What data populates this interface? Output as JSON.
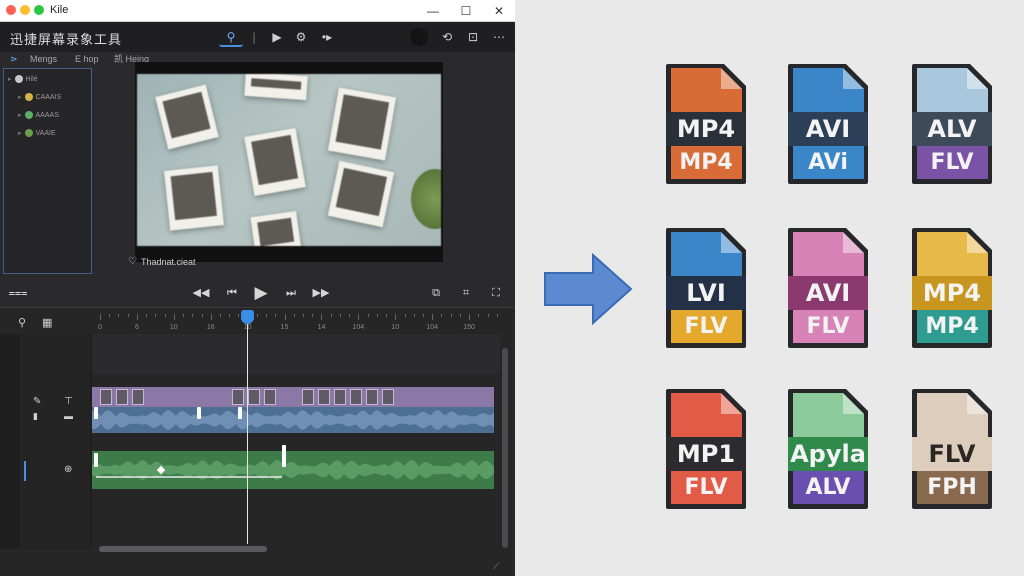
{
  "window": {
    "title": "Kile",
    "controls": {
      "minimize": "—",
      "maximize": "☐",
      "close": "✕"
    }
  },
  "app": {
    "name": "迅捷屏幕录象工具",
    "toolbar": {
      "search": "⚲",
      "sep": "|",
      "play": "▶",
      "gear": "⚙",
      "more": "•▸",
      "back": "⟲",
      "frame": "⊡",
      "dots": "⋯"
    }
  },
  "sidebar": {
    "tabs": [
      "Mengs",
      "E hop",
      "凯 Heing"
    ],
    "items": [
      {
        "label": "Hilé",
        "icon_color": "#c8c8c8"
      },
      {
        "label": "CAAAIS",
        "icon_color": "#d4b44a"
      },
      {
        "label": "AAAAS",
        "icon_color": "#5cae6a"
      },
      {
        "label": "VAAIE",
        "icon_color": "#6aa04a"
      }
    ]
  },
  "preview": {
    "label": "Thadnat.cieat"
  },
  "transport": {
    "rewind": "◀◀",
    "prev": "⏮",
    "play": "▶",
    "next": "⏭",
    "forward": "▶▶"
  },
  "timeline": {
    "ticks": [
      "0",
      "6",
      "10",
      "16",
      "10",
      "15",
      "14",
      "104",
      "10",
      "104",
      "150"
    ]
  },
  "files": [
    {
      "top": "MP4",
      "bottom": "MP4",
      "body_color": "#d96b36",
      "band_color": "#2b2f37",
      "bottom_color": "#d96b36"
    },
    {
      "top": "AVI",
      "bottom": "AVi",
      "body_color": "#3a86c8",
      "band_color": "#2b3f58",
      "bottom_color": "#3a86c8"
    },
    {
      "top": "ALV",
      "bottom": "FLV",
      "body_color": "#a9c7dd",
      "band_color": "#3d4a5a",
      "bottom_color": "#7a52a6"
    },
    {
      "top": "LVI",
      "bottom": "FLV",
      "body_color": "#3a86c8",
      "band_color": "#243046",
      "bottom_color": "#e4a82c"
    },
    {
      "top": "AVI",
      "bottom": "FLV",
      "body_color": "#d883b8",
      "band_color": "#8a3a6e",
      "bottom_color": "#d883b8"
    },
    {
      "top": "MP4",
      "bottom": "MP4",
      "body_color": "#e7b949",
      "band_color": "#c8951e",
      "bottom_color": "#2e9c91"
    },
    {
      "top": "MP1",
      "bottom": "FLV",
      "body_color": "#e25b46",
      "band_color": "#2c2c30",
      "bottom_color": "#e25b46"
    },
    {
      "top": "Apyla",
      "bottom": "ALV",
      "body_color": "#8ccc9c",
      "band_color": "#2f8a4c",
      "bottom_color": "#6a4fb0"
    },
    {
      "top": "FLV",
      "bottom": "FPH",
      "body_color": "#dccdbd",
      "band_color": "#dccdbd",
      "bottom_color": "#8a6a4e"
    }
  ]
}
